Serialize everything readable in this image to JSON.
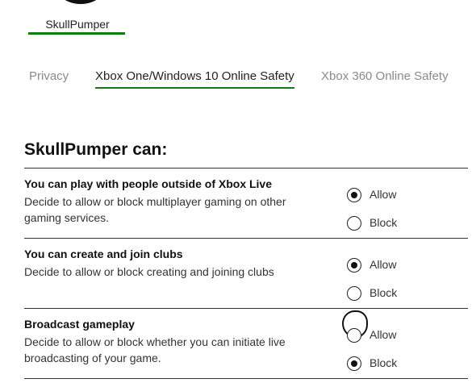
{
  "profile": {
    "gamertag": "SkullPumper"
  },
  "tabs": [
    {
      "label": "Privacy",
      "active": false
    },
    {
      "label": "Xbox One/Windows 10 Online Safety",
      "active": true
    },
    {
      "label": "Xbox 360 Online Safety",
      "active": false
    }
  ],
  "section": {
    "heading": "SkullPumper can:"
  },
  "settings": [
    {
      "title": "You can play with people outside of Xbox Live",
      "description": "Decide to allow or block multiplayer gaming on other gaming services.",
      "options": [
        {
          "label": "Allow",
          "selected": true
        },
        {
          "label": "Block",
          "selected": false
        }
      ]
    },
    {
      "title": "You can create and join clubs",
      "description": "Decide to allow or block creating and joining clubs",
      "options": [
        {
          "label": "Allow",
          "selected": true
        },
        {
          "label": "Block",
          "selected": false
        }
      ]
    },
    {
      "title": "Broadcast gameplay",
      "description": "Decide to allow or block whether you can initiate live broadcasting of your game.",
      "options": [
        {
          "label": "Allow",
          "selected": false
        },
        {
          "label": "Block",
          "selected": true
        }
      ]
    }
  ],
  "colors": {
    "accent": "#107c10",
    "text": "#1a1a1a",
    "muted": "#8a8a8a"
  }
}
